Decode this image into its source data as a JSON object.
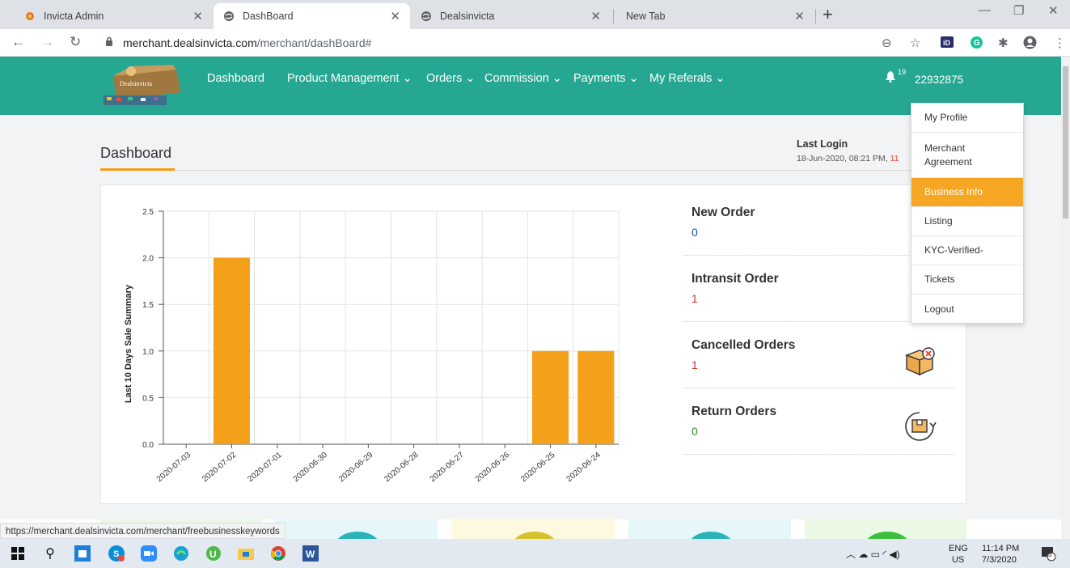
{
  "browser": {
    "tabs": [
      {
        "title": "Invicta Admin",
        "active": false
      },
      {
        "title": "DashBoard",
        "active": true
      },
      {
        "title": "Dealsinvicta",
        "active": false
      },
      {
        "title": "New Tab",
        "active": false
      }
    ],
    "url_host": "merchant.dealsinvicta.com",
    "url_path": "/merchant/dashBoard#",
    "status_url": "https://merchant.dealsinvicta.com/merchant/freebusinesskeywords"
  },
  "header": {
    "logo_text": "Dealsinvicta",
    "nav": [
      {
        "label": "Dashboard",
        "dropdown": false
      },
      {
        "label": "Product Management",
        "dropdown": true
      },
      {
        "label": "Orders",
        "dropdown": true
      },
      {
        "label": "Commission",
        "dropdown": true
      },
      {
        "label": "Payments",
        "dropdown": true
      },
      {
        "label": "My Referals",
        "dropdown": true
      }
    ],
    "notification_count": "19",
    "user_id": "22932875"
  },
  "user_menu": {
    "items": [
      "My Profile",
      "Merchant Agreement",
      "Business Info",
      "Listing",
      "KYC-Verified-",
      "Tickets",
      "Logout"
    ],
    "highlighted": "Business Info"
  },
  "dashboard": {
    "title": "Dashboard",
    "last_login_label": "Last Login",
    "last_login_value": "18-Jun-2020, 08:21 PM,",
    "last_login_extra": "11",
    "orders": [
      {
        "label": "New Order",
        "value": "0",
        "color": "#1f4e9c"
      },
      {
        "label": "Intransit Order",
        "value": "1",
        "color": "#c0392b"
      },
      {
        "label": "Cancelled Orders",
        "value": "1",
        "color": "#c0392b"
      },
      {
        "label": "Return Orders",
        "value": "0",
        "color": "#2e8b2e"
      }
    ]
  },
  "chart_data": {
    "type": "bar",
    "categories": [
      "2020-07-03",
      "2020-07-02",
      "2020-07-01",
      "2020-06-30",
      "2020-06-29",
      "2020-06-28",
      "2020-06-27",
      "2020-06-26",
      "2020-06-25",
      "2020-06-24"
    ],
    "values": [
      0,
      2,
      0,
      0,
      0,
      0,
      0,
      0,
      1,
      1
    ],
    "ylabel": "Last 10 Days Sale Summary",
    "xlabel": "",
    "ylim": [
      0,
      2.5
    ],
    "yticks": [
      "0.0",
      "0.5",
      "1.0",
      "1.5",
      "2.0",
      "2.5"
    ],
    "bar_color": "#f5a01a",
    "grid": true
  },
  "taskbar": {
    "lang_top": "ENG",
    "lang_bottom": "US",
    "time": "11:14 PM",
    "date": "7/3/2020",
    "notifications": "3"
  },
  "colors": {
    "header": "#25a792",
    "accent": "#f39c12"
  }
}
